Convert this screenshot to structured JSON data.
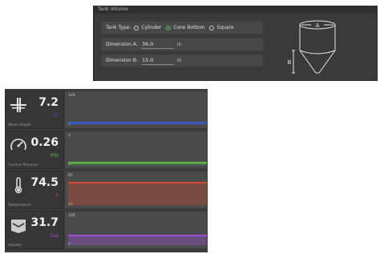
{
  "tank": {
    "title": "Tank Volume",
    "type_label": "Tank Type:",
    "options": [
      "Cylinder",
      "Cone Bottom",
      "Square"
    ],
    "selected": "Cone Bottom",
    "dim_a_label": "Dimension A:",
    "dim_a_value": "36.0",
    "dim_a_unit": "in",
    "dim_b_label": "Dimension B:",
    "dim_b_value": "15.0",
    "dim_b_unit": "in",
    "diagram_a": "A",
    "diagram_b": "B"
  },
  "gauges": [
    {
      "name": "Water Depth",
      "value": "7.2",
      "unit": "in",
      "color": "#3b5bd6",
      "ymax": "120",
      "ymin": "0",
      "level": 0.06
    },
    {
      "name": "Current Pressure",
      "value": "0.26",
      "unit": "PSI",
      "color": "#5bbf46",
      "ymax": "5",
      "ymin": "0",
      "level": 0.05
    },
    {
      "name": "Temperature",
      "value": "74.5",
      "unit": "F",
      "color": "#d04b32",
      "ymax": "85",
      "ymin": "45",
      "level": 0.74
    },
    {
      "name": "Volume",
      "value": "31.7",
      "unit": "Gal",
      "color": "#a14fd6",
      "ymax": "100",
      "ymin": "0",
      "level": 0.3
    }
  ]
}
